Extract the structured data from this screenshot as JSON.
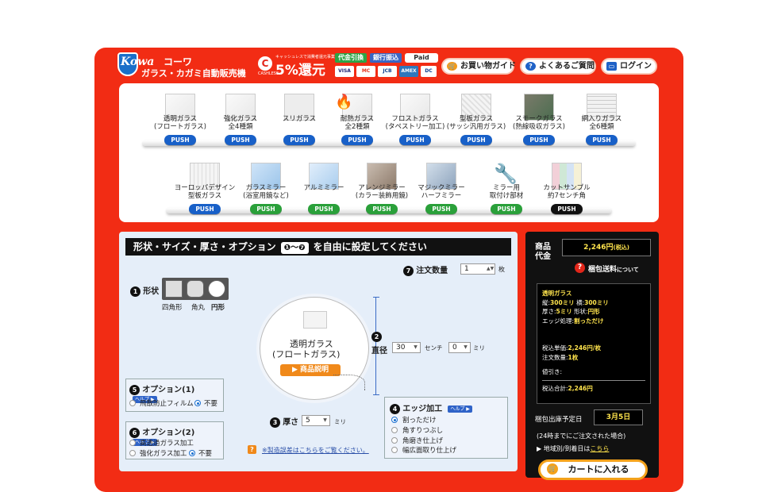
{
  "header": {
    "brand_en": "Kowa",
    "brand_jp": "コーワ",
    "subtitle": "ガラス・カガミ自動販売機",
    "cashless": {
      "small_text": "キャッシュレスで消費者還元事業加盟店",
      "label": "CASHLESS",
      "big_text": "5%還元"
    },
    "payment_badges": [
      "代金引換",
      "銀行振込",
      "Paid"
    ],
    "cards": [
      "VISA",
      "MC",
      "JCB",
      "AMEX",
      "DC"
    ],
    "nav": [
      {
        "label": "お買い物ガイド",
        "icon": "cart-icon"
      },
      {
        "label": "よくあるご質問",
        "icon": "question-icon"
      },
      {
        "label": "ログイン",
        "icon": "monitor-icon"
      }
    ]
  },
  "products_row1": [
    {
      "name": "透明ガラス\n(フロートガラス)",
      "push": "PUSH"
    },
    {
      "name": "強化ガラス\n全4種類",
      "push": "PUSH"
    },
    {
      "name": "スリガラス",
      "push": "PUSH"
    },
    {
      "name": "耐熱ガラス\n全2種類",
      "push": "PUSH"
    },
    {
      "name": "フロストガラス\n(タペストリー加工)",
      "push": "PUSH"
    },
    {
      "name": "型板ガラス\n(サッシ汎用ガラス)",
      "push": "PUSH"
    },
    {
      "name": "スモークガラス\n(熱線吸収ガラス)",
      "push": "PUSH"
    },
    {
      "name": "網入りガラス\n全6種類",
      "push": "PUSH"
    }
  ],
  "products_row2": [
    {
      "name": "ヨーロッパデザイン\n型板ガラス",
      "push": "PUSH",
      "color": "#1860c8"
    },
    {
      "name": "ガラスミラー\n(浴室用鏡など)",
      "push": "PUSH",
      "color": "#2aa03a"
    },
    {
      "name": "アルミミラー",
      "push": "PUSH",
      "color": "#2aa03a"
    },
    {
      "name": "アレンジミラー\n(カラー装飾用鏡)",
      "push": "PUSH",
      "color": "#2aa03a"
    },
    {
      "name": "マジックミラー\nハーフミラー",
      "push": "PUSH",
      "color": "#2aa03a"
    },
    {
      "name": "ミラー用\n取付け部材",
      "push": "PUSH",
      "color": "#2aa03a"
    },
    {
      "name": "カットサンプル\n約7センチ角",
      "push": "PUSH",
      "color": "#111111"
    }
  ],
  "config": {
    "title_prefix": "形状・サイズ・厚さ・オプション",
    "title_range": "❶〜❼",
    "title_suffix": "を自由に設定してください",
    "quantity": {
      "num": "7",
      "label": "注文数量",
      "value": "1",
      "unit": "枚"
    },
    "shape": {
      "num": "1",
      "label": "形状",
      "options": [
        "四角形",
        "角丸",
        "円形"
      ],
      "selected": "円形"
    },
    "preview": {
      "name_line1": "透明ガラス",
      "name_line2": "(フロートガラス)",
      "button": "商品説明"
    },
    "diameter": {
      "num": "2",
      "label": "直径",
      "cm_value": "30",
      "cm_unit": "センチ",
      "mm_value": "0",
      "mm_unit": "ミリ"
    },
    "thickness": {
      "num": "3",
      "label": "厚さ",
      "value": "5",
      "unit": "ミリ"
    },
    "edge": {
      "num": "4",
      "label": "エッジ加工",
      "help": "ヘルプ",
      "options": [
        "割っただけ",
        "角すりつぶし",
        "角磨き仕上げ",
        "幅広面取り仕上げ"
      ],
      "selected_index": 0
    },
    "option1": {
      "num": "5",
      "label": "オプション(1)",
      "help": "ヘルプ",
      "options": [
        "飛散防止フィルム",
        "不要"
      ],
      "selected_index": 1
    },
    "option2": {
      "num": "6",
      "label": "オプション(2)",
      "help": "ヘルプ",
      "options": [
        "高透過ガラス加工",
        "強化ガラス加工",
        "不要"
      ],
      "selected_index": 2
    },
    "note": "※製造誤差はこちらをご覧ください。"
  },
  "cart": {
    "price_label_1": "商品",
    "price_label_2": "代金",
    "price_value": "2,246円",
    "price_tax": "(税込)",
    "shipping_link": "梱包送料",
    "shipping_suffix": "について",
    "summary": {
      "product": "透明ガラス",
      "line1a": "縦:",
      "line1b": "300ミリ",
      "line1c": "横:",
      "line1d": "300ミリ",
      "line2a": "厚さ:",
      "line2b": "5ミリ",
      "line2c": "形状:",
      "line2d": "円形",
      "line3a": "エッジ処理:",
      "line3b": "割っただけ",
      "unit_label": "税込単価:",
      "unit_value": "2,246円/枚",
      "qty_label": "注文数量:",
      "qty_value": "1枚",
      "discount_label": "値引き:",
      "total_label": "税込合計:",
      "total_value": "2,246円"
    },
    "ship_label": "梱包出庫予定日",
    "ship_date": "3月5日",
    "ship_note": "(24時までにご注文された場合)",
    "region_label": "地域別/到着日は",
    "region_link": "こちら",
    "button": "カートに入れる"
  },
  "colors": {
    "frame": "#f22c14",
    "push_blue": "#1860c8",
    "push_green": "#2aa03a",
    "accent_yellow": "#ffe44d"
  }
}
